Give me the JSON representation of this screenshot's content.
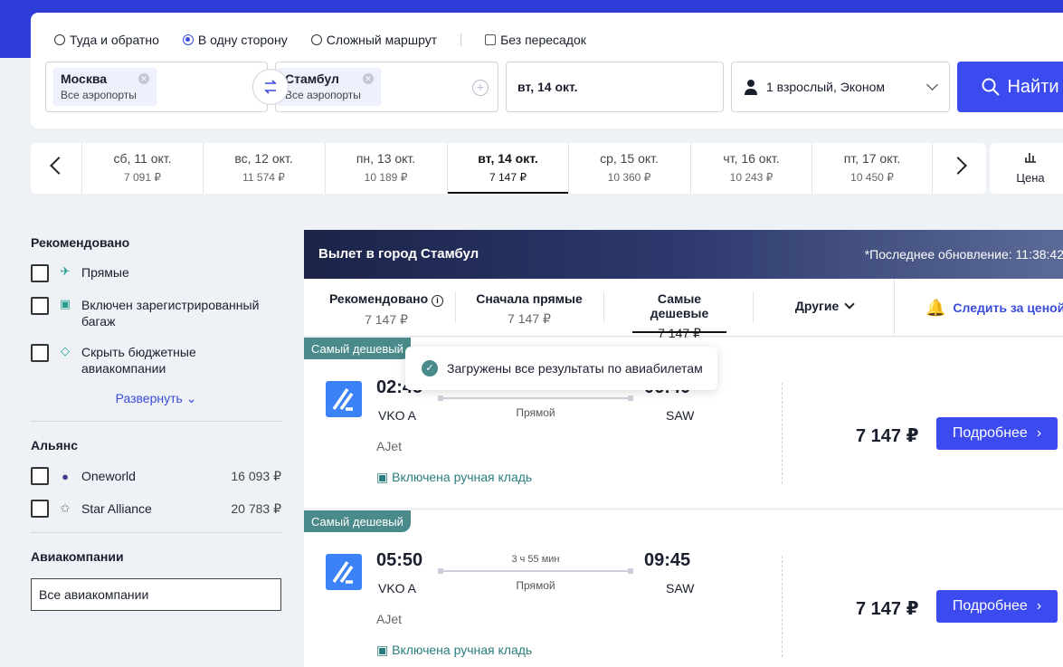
{
  "search": {
    "trip_types": [
      "Туда и обратно",
      "В одну сторону",
      "Сложный маршрут"
    ],
    "selected_trip_type": "В одну сторону",
    "nonstop_label": "Без пересадок",
    "from": {
      "city": "Москва",
      "sub": "Все аэропорты"
    },
    "to": {
      "city": "Стамбул",
      "sub": "Все аэропорты"
    },
    "date": "вт, 14 окт.",
    "passengers": "1 взрослый, Эконом",
    "find_label": "Найти"
  },
  "datebar": {
    "days": [
      {
        "date": "сб, 11 окт.",
        "price": "7 091 ₽"
      },
      {
        "date": "вс, 12 окт.",
        "price": "11 574 ₽"
      },
      {
        "date": "пн, 13 окт.",
        "price": "10 189 ₽"
      },
      {
        "date": "вт, 14 окт.",
        "price": "7 147 ₽"
      },
      {
        "date": "ср, 15 окт.",
        "price": "10 360 ₽"
      },
      {
        "date": "чт, 16 окт.",
        "price": "10 243 ₽"
      },
      {
        "date": "пт, 17 окт.",
        "price": "10 450 ₽"
      }
    ],
    "active_index": 3,
    "price_sort_label": "Цена"
  },
  "sidebar": {
    "recommended_title": "Рекомендовано",
    "recommended_items": [
      {
        "label": "Прямые",
        "icon": "plane-icon"
      },
      {
        "label": "Включен зарегистрированный багаж",
        "icon": "luggage-icon"
      },
      {
        "label": "Скрыть бюджетные авиакомпании",
        "icon": "tag-icon"
      }
    ],
    "expand_label": "Развернуть",
    "alliance_title": "Альянс",
    "alliances": [
      {
        "label": "Oneworld",
        "count": "16 093 ₽"
      },
      {
        "label": "Star Alliance",
        "count": "20 783 ₽"
      }
    ],
    "airlines_title": "Авиакомпании",
    "airlines_value": "Все авиакомпании"
  },
  "results": {
    "title": "Вылет в город Стамбул",
    "updated": "*Последнее обновление: 11:38:42",
    "tabs": [
      {
        "name": "Рекомендовано",
        "price": "7 147 ₽"
      },
      {
        "name": "Сначала прямые",
        "price": "7 147 ₽"
      },
      {
        "name": "Самые дешевые",
        "price": "7 147 ₽"
      },
      {
        "name": "Другие",
        "price": ""
      }
    ],
    "follow_label": "Следить за ценой",
    "toast": "Загружены все результаты по авиабилетам",
    "flights": [
      {
        "badge": "Самый дешевый",
        "dep": "02:45",
        "arr": "06:40",
        "from": "VKO A",
        "to": "SAW",
        "duration": "",
        "type": "Прямой",
        "carrier": "AJet",
        "bag": "Включена ручная кладь",
        "price": "7 147 ₽",
        "button": "Подробнее"
      },
      {
        "badge": "Самый дешевый",
        "dep": "05:50",
        "arr": "09:45",
        "from": "VKO A",
        "to": "SAW",
        "duration": "3 ч 55 мин",
        "type": "Прямой",
        "carrier": "AJet",
        "bag": "Включена ручная кладь",
        "price": "7 147 ₽",
        "button": "Подробнее"
      }
    ]
  }
}
